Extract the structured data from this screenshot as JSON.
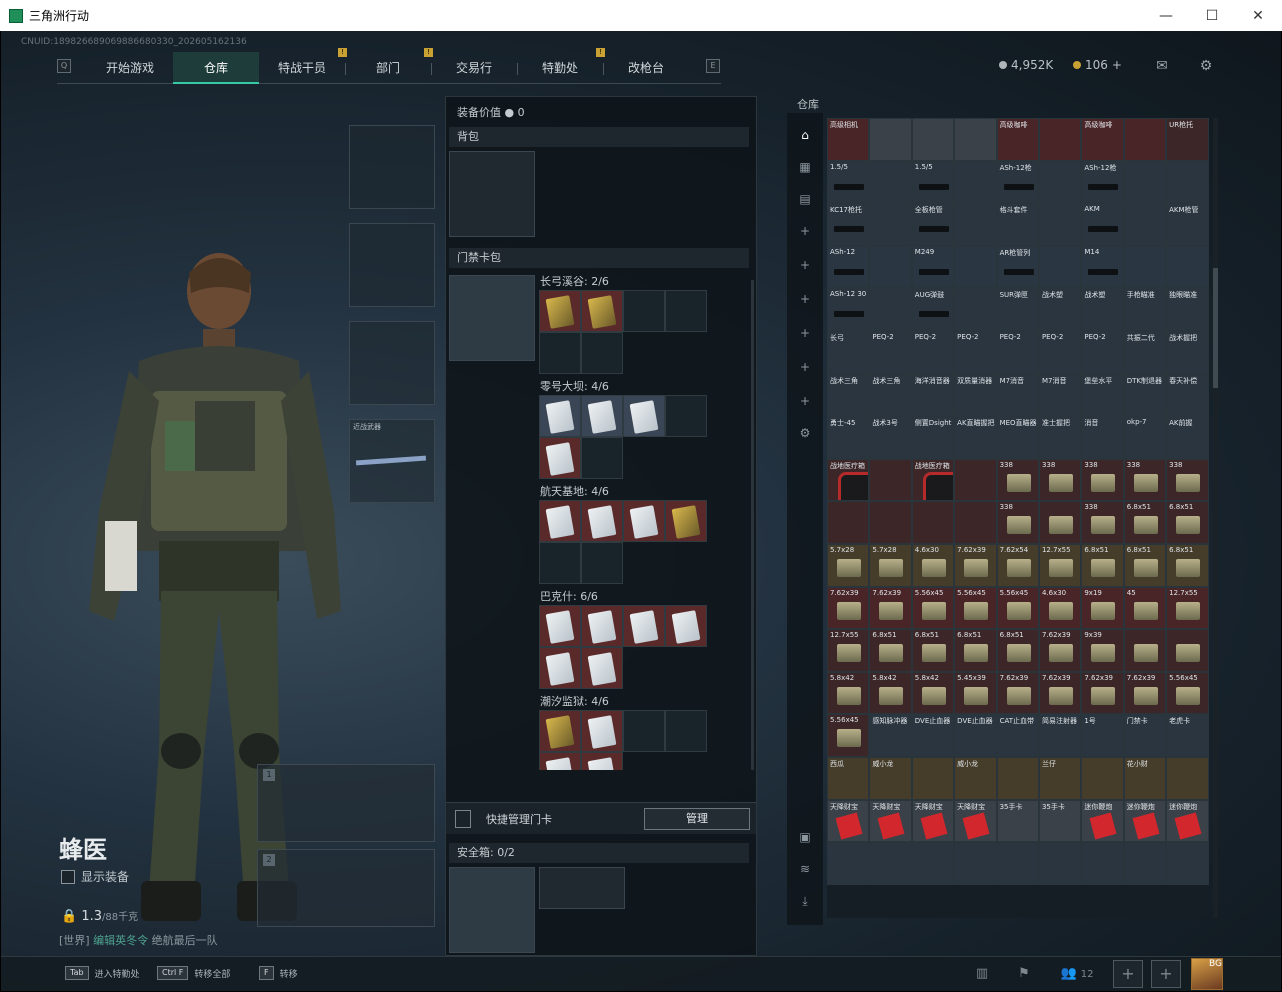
{
  "window": {
    "title": "三角洲行动",
    "minimize": "—",
    "maximize": "☐",
    "close": "✕"
  },
  "uid": "CNUID:189826689069886680330_202605162136",
  "nav": {
    "tabs": [
      {
        "label": "开始游戏"
      },
      {
        "label": "仓库",
        "active": true
      },
      {
        "label": "特战干员",
        "alert": "!"
      },
      {
        "label": "部门",
        "alert": "!"
      },
      {
        "label": "交易行"
      },
      {
        "label": "特勤处",
        "alert": "!"
      },
      {
        "label": "改枪台"
      }
    ],
    "left_key": "Q",
    "right_key": "E"
  },
  "currency": {
    "coins": "4,952K",
    "tokens": "106",
    "plus": "+"
  },
  "equipment_value": {
    "label": "装备价值",
    "value": "0"
  },
  "backpack": {
    "label": "背包"
  },
  "keycard_pack": {
    "label": "门禁卡包",
    "maps": [
      {
        "name": "长弓溪谷: 2/6"
      },
      {
        "name": "零号大坝: 4/6"
      },
      {
        "name": "航天基地: 4/6"
      },
      {
        "name": "巴克什: 6/6"
      },
      {
        "name": "潮汐监狱: 4/6"
      }
    ]
  },
  "quick_manage": {
    "label": "快捷管理门卡",
    "button": "管理"
  },
  "safe_box": {
    "label": "安全箱:",
    "capacity": "0/2"
  },
  "weapon_slot_3_label": "近战武器",
  "operator": {
    "name": "蜂医",
    "show_equipment": "显示装备",
    "weight": "1.3",
    "weight_max": "/88千克"
  },
  "chat": {
    "channel": "[世界]",
    "user": "编辑英冬令",
    "text": "绝航最后一队"
  },
  "warehouse": {
    "label": "仓库",
    "rows": [
      [
        [
          "高级相机",
          "c5",
          ""
        ],
        [
          "",
          "c2",
          ""
        ],
        [
          "",
          "c2",
          ""
        ],
        [
          "",
          "c2",
          ""
        ],
        [
          "高级咖啡",
          "c5",
          ""
        ],
        [
          "",
          "c5",
          ""
        ],
        [
          "高级咖啡",
          "c5",
          ""
        ],
        [
          "",
          "c5",
          ""
        ],
        [
          "UR枪托",
          "c1",
          ""
        ]
      ],
      [
        [
          "1.5/5",
          "c0",
          "gun"
        ],
        [
          "",
          "c0",
          ""
        ],
        [
          "1.5/5",
          "c0",
          "gun"
        ],
        [
          "",
          "c0",
          ""
        ],
        [
          "ASh-12枪",
          "c0",
          "gun"
        ],
        [
          "",
          "c0",
          ""
        ],
        [
          "ASh-12枪",
          "c0",
          "gun"
        ],
        [
          "",
          "c0",
          ""
        ],
        [
          "",
          "c0",
          ""
        ]
      ],
      [
        [
          "KC17枪托",
          "c0",
          "gun"
        ],
        [
          "",
          "c0",
          ""
        ],
        [
          "全板枪管",
          "c0",
          "gun"
        ],
        [
          "",
          "c0",
          ""
        ],
        [
          "格斗套件",
          "c0",
          ""
        ],
        [
          "",
          "c0",
          ""
        ],
        [
          "AKM",
          "c0",
          "gun"
        ],
        [
          "",
          "c0",
          ""
        ],
        [
          "AKM枪管",
          "c0",
          ""
        ]
      ],
      [
        [
          "ASh-12",
          "c4",
          "gun"
        ],
        [
          "",
          "c4",
          ""
        ],
        [
          "M249",
          "c4",
          "gun"
        ],
        [
          "",
          "c4",
          ""
        ],
        [
          "AR枪管列",
          "c4",
          "gun"
        ],
        [
          "",
          "c4",
          ""
        ],
        [
          "M14",
          "c4",
          "gun"
        ],
        [
          "",
          "c4",
          ""
        ],
        [
          "",
          "c4",
          ""
        ]
      ],
      [
        [
          "ASh-12 30",
          "c0",
          "gun"
        ],
        [
          "",
          "c0",
          ""
        ],
        [
          "AUG弹鼓",
          "c0",
          "gun"
        ],
        [
          "",
          "c0",
          ""
        ],
        [
          "SUR弹匣",
          "c0",
          ""
        ],
        [
          "战术塑",
          "c0",
          ""
        ],
        [
          "战术塑",
          "c0",
          ""
        ],
        [
          "手枪瞄准",
          "c0",
          ""
        ],
        [
          "独眼瞄准",
          "c0",
          ""
        ]
      ],
      [
        [
          "长弓",
          "c0",
          ""
        ],
        [
          "PEQ-2",
          "c0",
          ""
        ],
        [
          "PEQ-2",
          "c0",
          ""
        ],
        [
          "PEQ-2",
          "c0",
          ""
        ],
        [
          "PEQ-2",
          "c0",
          ""
        ],
        [
          "PEQ-2",
          "c0",
          ""
        ],
        [
          "PEQ-2",
          "c0",
          ""
        ],
        [
          "共振二代",
          "c0",
          ""
        ],
        [
          "战术握把",
          "c0",
          ""
        ]
      ],
      [
        [
          "战术三角",
          "c0",
          ""
        ],
        [
          "战术三角",
          "c0",
          ""
        ],
        [
          "海洋消音器",
          "c0",
          ""
        ],
        [
          "双质量消器",
          "c0",
          ""
        ],
        [
          "M7消音",
          "c0",
          ""
        ],
        [
          "M7消音",
          "c0",
          ""
        ],
        [
          "堡垒水平",
          "c0",
          ""
        ],
        [
          "DTK制退器",
          "c0",
          ""
        ],
        [
          "春天补偿",
          "c0",
          ""
        ]
      ],
      [
        [
          "勇士-45",
          "c0",
          ""
        ],
        [
          "战术3号",
          "c0",
          ""
        ],
        [
          "侧置Dsight",
          "c0",
          ""
        ],
        [
          "AK直瞄握把",
          "c0",
          ""
        ],
        [
          "MEO直瞄器",
          "c0",
          ""
        ],
        [
          "准士握把",
          "c0",
          ""
        ],
        [
          "消音",
          "c0",
          ""
        ],
        [
          "okp-7",
          "c0",
          ""
        ],
        [
          "AK前握",
          "c0",
          ""
        ]
      ],
      [
        [
          "战地医疗箱",
          "c1",
          "med"
        ],
        [
          "",
          "c1",
          ""
        ],
        [
          "战地医疗箱",
          "c1",
          "med"
        ],
        [
          "",
          "c1",
          ""
        ],
        [
          "338",
          "c1",
          "box"
        ],
        [
          "338",
          "c1",
          "box"
        ],
        [
          "338",
          "c1",
          "box"
        ],
        [
          "338",
          "c1",
          "box"
        ],
        [
          "338",
          "c1",
          "box"
        ]
      ],
      [
        [
          "",
          "c1",
          ""
        ],
        [
          "",
          "c1",
          ""
        ],
        [
          "",
          "c1",
          ""
        ],
        [
          "",
          "c1",
          ""
        ],
        [
          "338",
          "c1",
          "box"
        ],
        [
          "",
          "c1",
          "box"
        ],
        [
          "338",
          "c1",
          "box"
        ],
        [
          "6.8x51",
          "c1",
          "box"
        ],
        [
          "6.8x51",
          "c1",
          "box"
        ]
      ],
      [
        [
          "5.7x28",
          "c3",
          "box"
        ],
        [
          "5.7x28",
          "c3",
          "box"
        ],
        [
          "4.6x30",
          "c3",
          "box"
        ],
        [
          "7.62x39",
          "c3",
          "box"
        ],
        [
          "7.62x54",
          "c3",
          "box"
        ],
        [
          "12.7x55",
          "c3",
          "box"
        ],
        [
          "6.8x51",
          "c3",
          "box"
        ],
        [
          "6.8x51",
          "c3",
          "box"
        ],
        [
          "6.8x51",
          "c3",
          "box"
        ]
      ],
      [
        [
          "7.62x39",
          "c5",
          "box"
        ],
        [
          "7.62x39",
          "c5",
          "box"
        ],
        [
          "5.56x45",
          "c5",
          "box"
        ],
        [
          "5.56x45",
          "c5",
          "box"
        ],
        [
          "5.56x45",
          "c5",
          "box"
        ],
        [
          "4.6x30",
          "c5",
          "box"
        ],
        [
          "9x19",
          "c5",
          "box"
        ],
        [
          "45",
          "c5",
          "box"
        ],
        [
          "12.7x55",
          "c5",
          "box"
        ]
      ],
      [
        [
          "12.7x55",
          "c1",
          "box"
        ],
        [
          "6.8x51",
          "c1",
          "box"
        ],
        [
          "6.8x51",
          "c1",
          "box"
        ],
        [
          "6.8x51",
          "c1",
          "box"
        ],
        [
          "6.8x51",
          "c1",
          "box"
        ],
        [
          "7.62x39",
          "c1",
          "box"
        ],
        [
          "9x39",
          "c1",
          "box"
        ],
        [
          "",
          "c1",
          "box"
        ],
        [
          "",
          "c1",
          "box"
        ]
      ],
      [
        [
          "5.8x42",
          "c1",
          "box"
        ],
        [
          "5.8x42",
          "c1",
          "box"
        ],
        [
          "5.8x42",
          "c1",
          "box"
        ],
        [
          "5.45x39",
          "c1",
          "box"
        ],
        [
          "7.62x39",
          "c1",
          "box"
        ],
        [
          "7.62x39",
          "c1",
          "box"
        ],
        [
          "7.62x39",
          "c1",
          "box"
        ],
        [
          "7.62x39",
          "c1",
          "box"
        ],
        [
          "5.56x45",
          "c1",
          "box"
        ]
      ],
      [
        [
          "5.56x45",
          "c1",
          "box"
        ],
        [
          "感知脉冲器",
          "c0",
          ""
        ],
        [
          "DVE止血器",
          "c0",
          ""
        ],
        [
          "DVE止血器",
          "c0",
          ""
        ],
        [
          "CAT止血带",
          "c0",
          ""
        ],
        [
          "简易注射器",
          "c0",
          ""
        ],
        [
          "1号",
          "c0",
          ""
        ],
        [
          "门禁卡",
          "c0",
          ""
        ],
        [
          "老虎卡",
          "c0",
          ""
        ]
      ],
      [
        [
          "西瓜",
          "c3",
          ""
        ],
        [
          "威小龙",
          "c3",
          ""
        ],
        [
          "",
          "c3",
          ""
        ],
        [
          "威小龙",
          "c3",
          ""
        ],
        [
          "",
          "c3",
          ""
        ],
        [
          "兰仔",
          "c3",
          ""
        ],
        [
          "",
          "c3",
          ""
        ],
        [
          "花小财",
          "c3",
          ""
        ],
        [
          "",
          "c3",
          ""
        ]
      ],
      [
        [
          "天降财宝",
          "c2",
          "red"
        ],
        [
          "天降财宝",
          "c2",
          "red"
        ],
        [
          "天降财宝",
          "c2",
          "red"
        ],
        [
          "天降财宝",
          "c2",
          "red"
        ],
        [
          "35手卡",
          "c2",
          ""
        ],
        [
          "35手卡",
          "c2",
          ""
        ],
        [
          "迷你鞭炮",
          "c2",
          "red"
        ],
        [
          "迷你鞭炮",
          "c2",
          "red"
        ],
        [
          "迷你鞭炮",
          "c2",
          "red"
        ]
      ],
      [
        [
          "",
          "c0",
          ""
        ],
        [
          "",
          "c0",
          ""
        ],
        [
          "",
          "c0",
          ""
        ],
        [
          "",
          "c0",
          ""
        ],
        [
          "",
          "c0",
          ""
        ],
        [
          "",
          "c0",
          ""
        ],
        [
          "",
          "c0",
          ""
        ],
        [
          "",
          "c0",
          ""
        ],
        [
          "",
          "c0",
          ""
        ]
      ]
    ]
  },
  "bottom": {
    "hints": [
      {
        "key": "Tab",
        "label": "进入特勤处"
      },
      {
        "key": "Ctrl F",
        "label": "转移全部"
      },
      {
        "key": "F",
        "label": "转移"
      }
    ],
    "friends_count": "12",
    "avatar_level": "BG"
  }
}
